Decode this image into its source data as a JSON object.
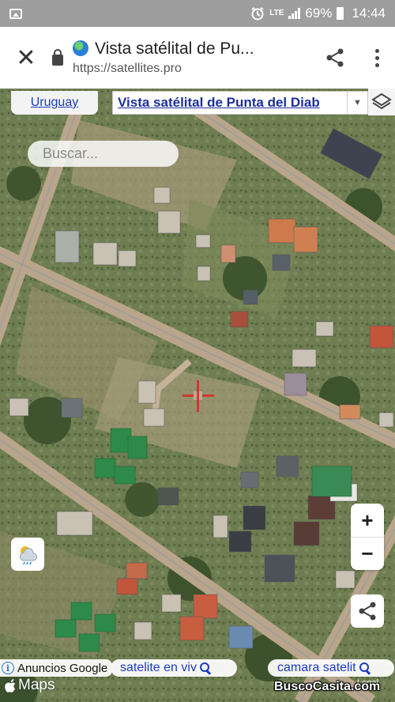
{
  "status_bar": {
    "network": "LTE",
    "battery": "69%",
    "time": "14:44",
    "icons": [
      "gallery-icon",
      "alarm-icon",
      "signal-icon",
      "battery-icon"
    ]
  },
  "browser": {
    "title": "Vista satélital de Pu...",
    "url_prefix": "https://",
    "url_domain": "satellites.pro",
    "icons": [
      "close-icon",
      "lock-icon",
      "globe-icon",
      "share-icon",
      "more-vert-icon"
    ]
  },
  "map": {
    "country_link": "Uruguay",
    "place_select": "Vista satélital de Punta del Diab",
    "search_placeholder": "Buscar...",
    "zoom_in": "+",
    "zoom_out": "−",
    "ads_label": "Anuncios Google",
    "ad_pills": [
      "satelite en viv",
      "camara satelit"
    ],
    "provider": "Maps",
    "legal": "Legal",
    "watermark": "BuscoCasita.com",
    "icons": [
      "layers-icon",
      "crosshair-icon",
      "weather-icon",
      "share-icon",
      "info-icon",
      "search-icon",
      "apple-icon"
    ]
  },
  "colors": {
    "link": "#1a3dbf",
    "ground": "#6b7b4e",
    "road": "#b9a58b",
    "crosshair": "#d72828"
  }
}
